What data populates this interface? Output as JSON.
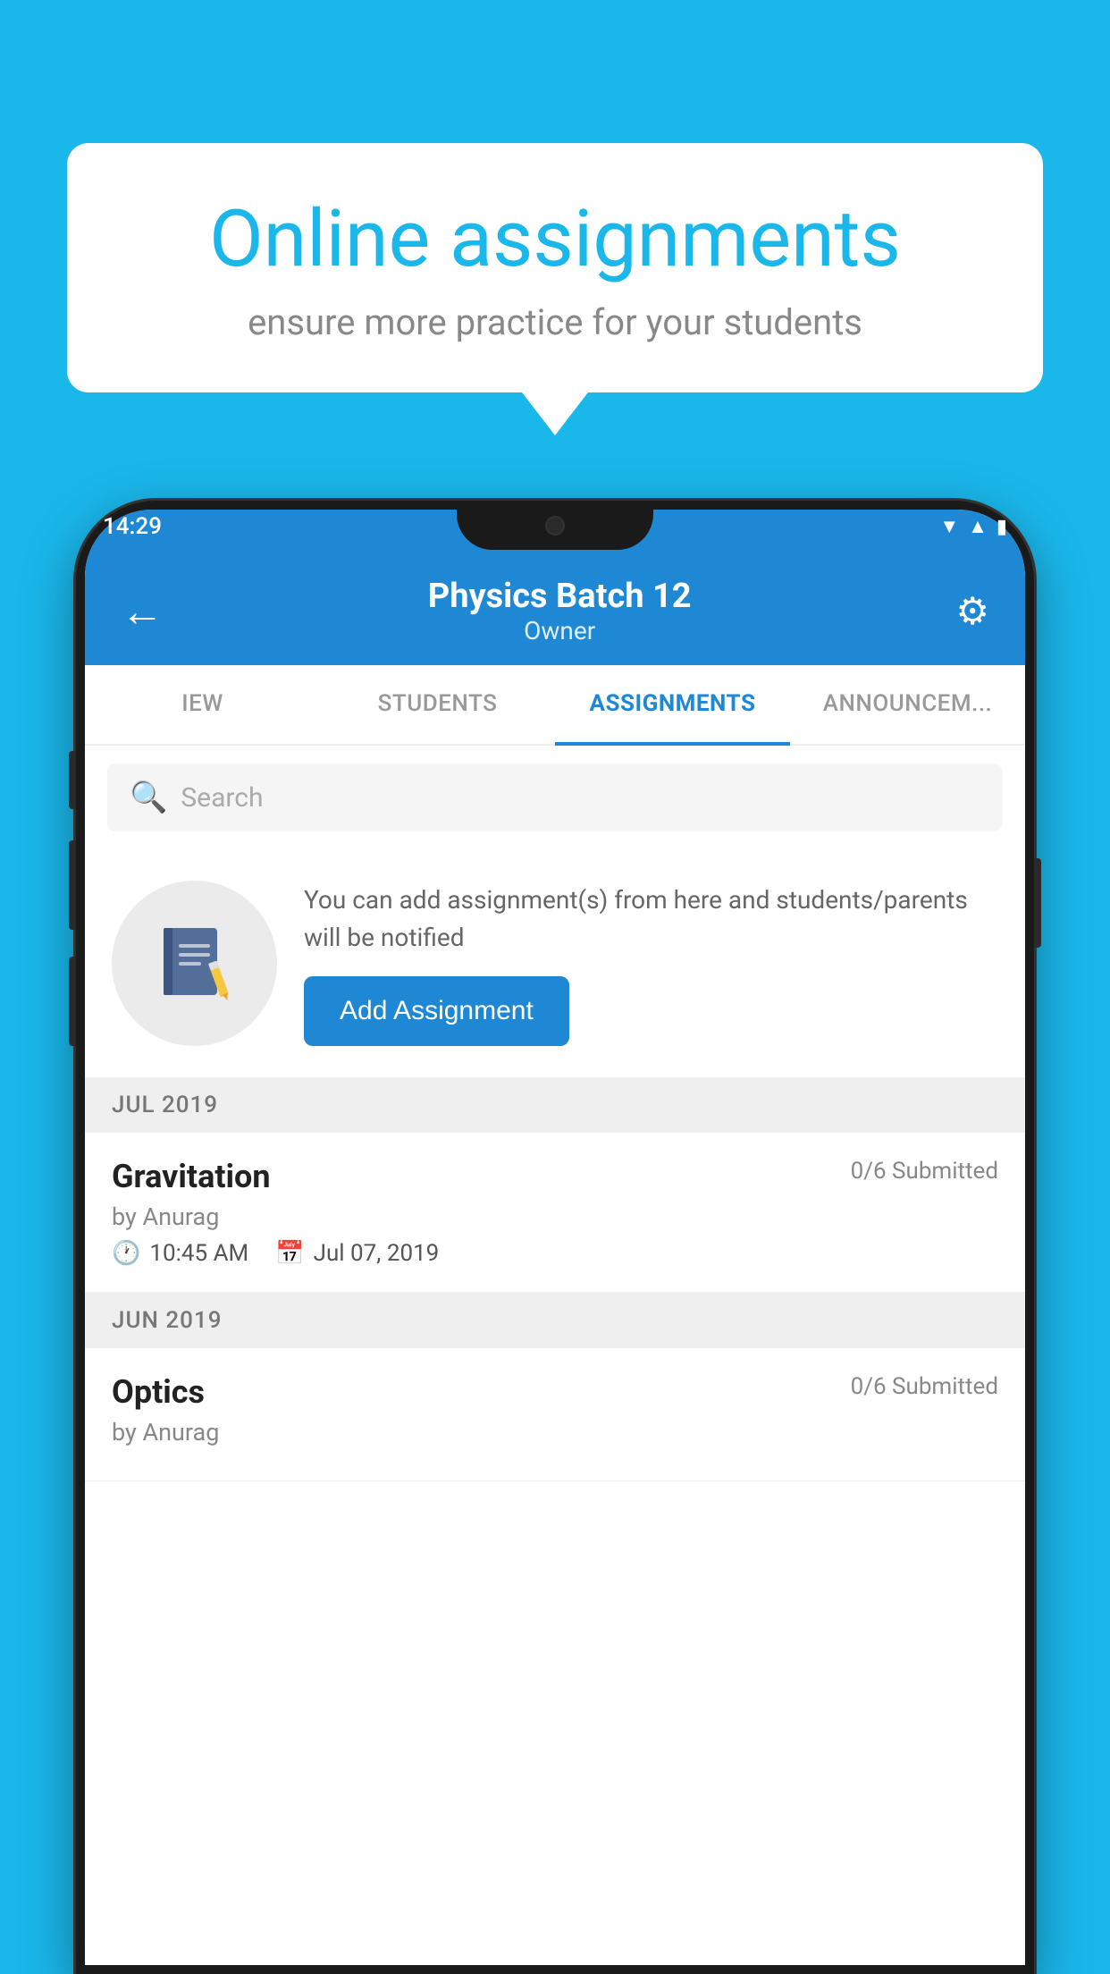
{
  "background_color": "#1ab7ea",
  "bubble": {
    "title": "Online assignments",
    "subtitle": "ensure more practice for your students"
  },
  "phone": {
    "status_bar": {
      "time": "14:29",
      "icons": [
        "wifi",
        "signal",
        "battery"
      ]
    },
    "header": {
      "title": "Physics Batch 12",
      "subtitle": "Owner",
      "back_label": "←",
      "settings_label": "⚙"
    },
    "tabs": [
      {
        "label": "IEW",
        "active": false
      },
      {
        "label": "STUDENTS",
        "active": false
      },
      {
        "label": "ASSIGNMENTS",
        "active": true
      },
      {
        "label": "ANNOUNCEM...",
        "active": false
      }
    ],
    "search": {
      "placeholder": "Search"
    },
    "add_assignment_section": {
      "description": "You can add assignment(s) from here and students/parents will be notified",
      "button_label": "Add Assignment"
    },
    "assignment_sections": [
      {
        "month": "JUL 2019",
        "assignments": [
          {
            "name": "Gravitation",
            "submitted": "0/6 Submitted",
            "by": "by Anurag",
            "time": "10:45 AM",
            "date": "Jul 07, 2019"
          }
        ]
      },
      {
        "month": "JUN 2019",
        "assignments": [
          {
            "name": "Optics",
            "submitted": "0/6 Submitted",
            "by": "by Anurag",
            "time": "",
            "date": ""
          }
        ]
      }
    ]
  }
}
